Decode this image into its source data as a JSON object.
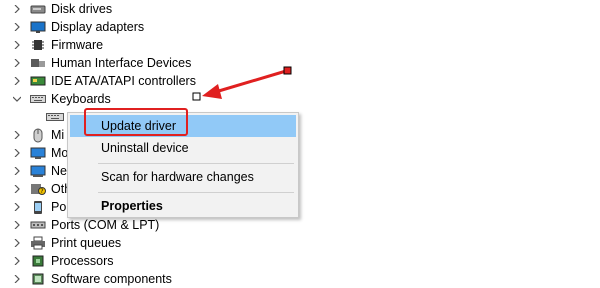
{
  "tree": {
    "rows": [
      {
        "label": "Disk drives",
        "icon": "disk-drive-icon",
        "expanded": false
      },
      {
        "label": "Display adapters",
        "icon": "display-adapter-icon",
        "expanded": false
      },
      {
        "label": "Firmware",
        "icon": "firmware-chip-icon",
        "expanded": false
      },
      {
        "label": "Human Interface Devices",
        "icon": "hid-icon",
        "expanded": false
      },
      {
        "label": "IDE ATA/ATAPI controllers",
        "icon": "ide-controller-icon",
        "expanded": false
      },
      {
        "label": "Keyboards",
        "icon": "keyboard-icon",
        "expanded": true
      },
      {
        "label": "Mi",
        "icon": "mouse-icon",
        "expanded": false
      },
      {
        "label": "Mo",
        "icon": "monitor-icon",
        "expanded": false
      },
      {
        "label": "Ne",
        "icon": "network-adapter-icon",
        "expanded": false
      },
      {
        "label": "Oth",
        "icon": "other-device-icon",
        "expanded": false
      },
      {
        "label": "Por",
        "icon": "portable-device-icon",
        "expanded": false
      },
      {
        "label": "Ports (COM & LPT)",
        "icon": "port-icon",
        "expanded": false
      },
      {
        "label": "Print queues",
        "icon": "printer-icon",
        "expanded": false
      },
      {
        "label": "Processors",
        "icon": "processor-icon",
        "expanded": false
      },
      {
        "label": "Software components",
        "icon": "software-component-icon",
        "expanded": false
      }
    ]
  },
  "context_menu": {
    "update_driver": "Update driver",
    "uninstall_device": "Uninstall device",
    "scan_hardware": "Scan for hardware changes",
    "properties": "Properties"
  },
  "colors": {
    "highlight": "#91c9f7",
    "annotation_red": "#e02020"
  }
}
